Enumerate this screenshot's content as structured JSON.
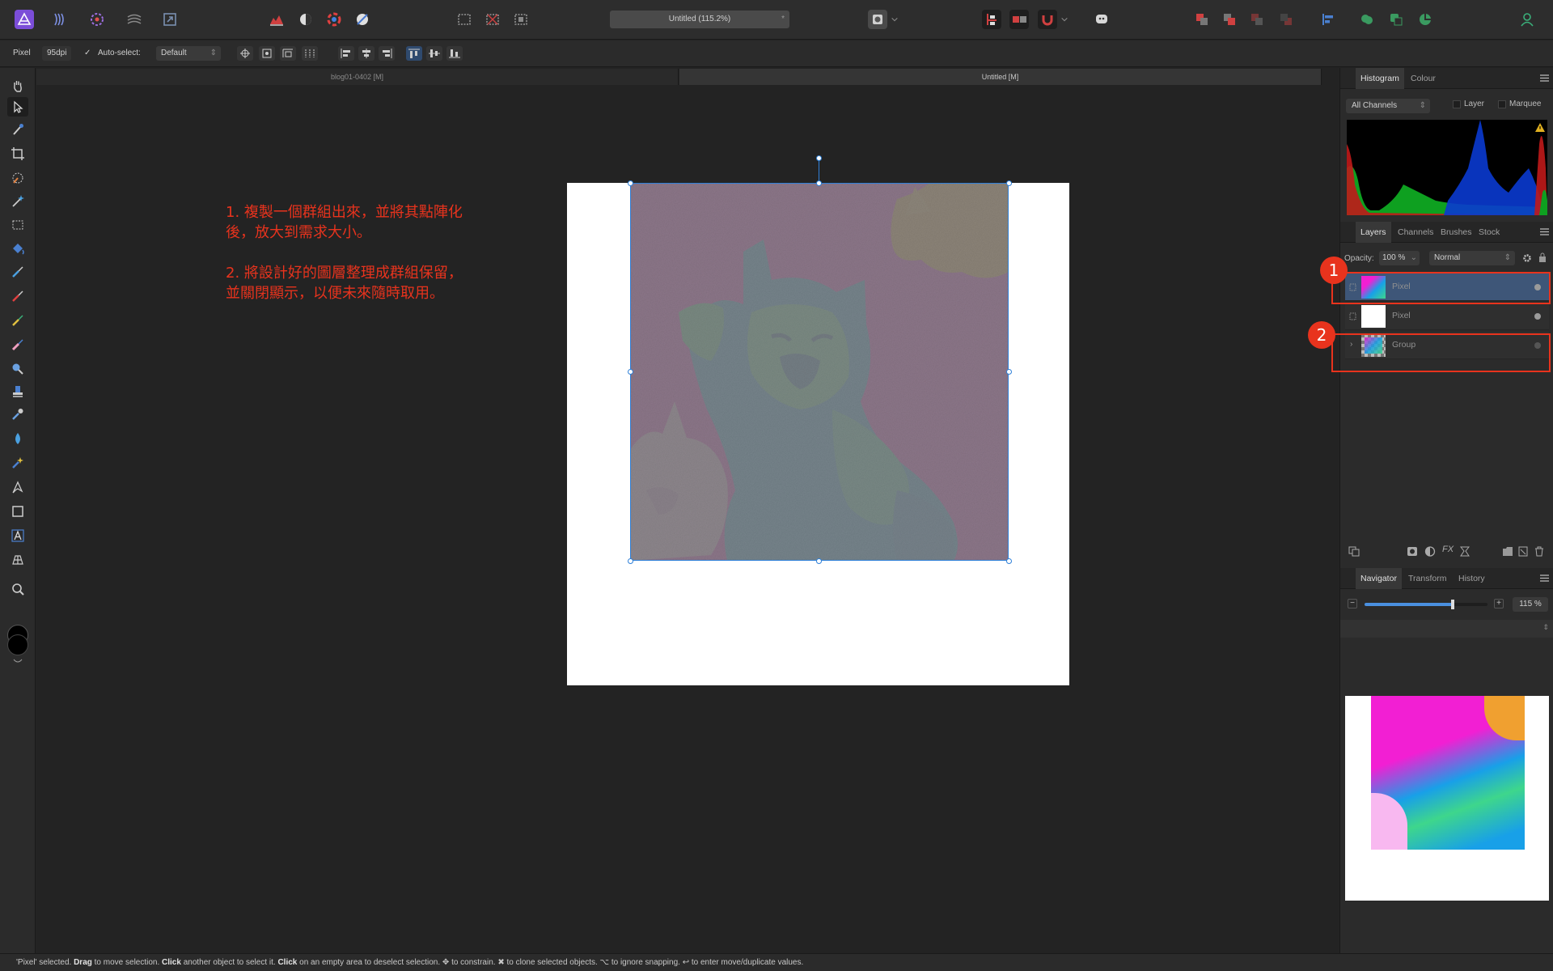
{
  "app": {
    "title": "Untitled (115.2%)",
    "modified_mark": "*"
  },
  "context_bar": {
    "tool_name": "Pixel",
    "dpi": "95dpi",
    "auto_select_label": "Auto-select:",
    "auto_select_value": "Default"
  },
  "doc_tabs": [
    "blog01-0402 [M]",
    "Untitled [M]"
  ],
  "annotation": {
    "step1_line1": "1. 複製一個群組出來，並將其點陣化",
    "step1_line2": "後，放大到需求大小。",
    "step2_line1": "2. 將設計好的圖層整理成群組保留，",
    "step2_line2": "並關閉顯示，以便未來隨時取用。"
  },
  "histogram_panel": {
    "tabs": [
      "Histogram",
      "Colour"
    ],
    "channel_select": "All Channels",
    "layer_label": "Layer",
    "marquee_label": "Marquee"
  },
  "layers_panel": {
    "tabs": [
      "Layers",
      "Channels",
      "Brushes",
      "Stock"
    ],
    "opacity_label": "Opacity:",
    "opacity_value": "100 %",
    "blend_mode": "Normal",
    "layers": [
      {
        "name": "Pixel",
        "selected": true
      },
      {
        "name": "Pixel",
        "selected": false
      },
      {
        "name": "Group",
        "selected": false
      }
    ],
    "badges": [
      "1",
      "2"
    ]
  },
  "navigator_panel": {
    "tabs": [
      "Navigator",
      "Transform",
      "History"
    ],
    "zoom_value": "115 %",
    "zoom_fraction": 0.72
  },
  "status_bar": {
    "part1": "'Pixel' selected. ",
    "drag": "Drag",
    "part2": " to move selection. ",
    "click1": "Click",
    "part3": " another object to select it. ",
    "click2": "Click",
    "part4": " on an empty area to deselect selection. ✥ to constrain. ✖ to clone selected objects. ⌥ to ignore snapping. ↩ to enter move/duplicate values."
  },
  "colors": {
    "accent_red": "#e8331d",
    "selection_blue": "#2f80d8",
    "image_magenta": "#f21fd3",
    "selected_layer": "#3e5678"
  }
}
